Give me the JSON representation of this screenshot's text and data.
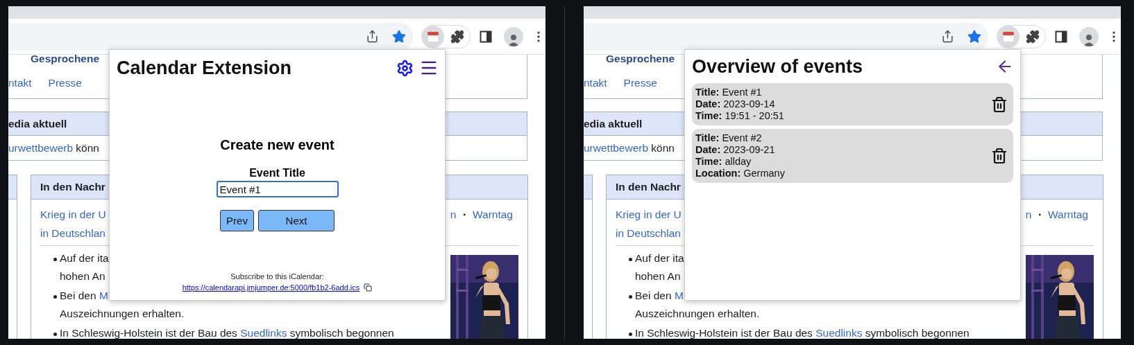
{
  "panes": [
    {
      "wiki": {
        "nav_top": "Gesprochene",
        "nav_links": [
          "ntakt",
          "Presse"
        ],
        "current_title": "edia aktuell",
        "current_text": [
          {
            "kind": "link",
            "text": "urwettbewerb"
          },
          {
            "kind": "text",
            "text": " könn"
          }
        ],
        "news_title": "In den Nachr",
        "news_left": [
          "Krieg in der U",
          "in Deutschlan"
        ],
        "news_right": [
          "n",
          "▪",
          "Warntag"
        ],
        "bullets": [
          {
            "lines": [
              [
                {
                  "kind": "text",
                  "text": "Auf der ita"
                }
              ],
              [
                {
                  "kind": "text",
                  "text": "hohen An"
                }
              ]
            ]
          },
          {
            "lines": [
              [
                {
                  "kind": "text",
                  "text": "Bei den "
                },
                {
                  "kind": "link",
                  "text": "M"
                }
              ],
              [
                {
                  "kind": "text",
                  "text": "Auszeichnungen erhalten."
                }
              ]
            ]
          },
          {
            "lines": [
              [
                {
                  "kind": "text",
                  "text": "In Schleswig-Holstein ist der Bau des "
                },
                {
                  "kind": "link",
                  "text": "Suedlinks"
                },
                {
                  "kind": "text",
                  "text": " symbolisch begonnen"
                }
              ]
            ]
          }
        ]
      },
      "popup": {
        "kind": "create",
        "title": "Calendar Extension",
        "heading": "Create new event",
        "field_label": "Event Title",
        "field_value": "Event #1",
        "buttons": [
          "Prev",
          "Next"
        ],
        "subscribe_text": "Subscribe to this iCalendar:",
        "subscribe_link": "https://calendarapi.jmjumper.de:5000/fb1b2-6add.ics"
      }
    },
    {
      "wiki": {
        "nav_top": "Gesprochene",
        "nav_links": [
          "ntakt",
          "Presse"
        ],
        "current_title": "edia aktuell",
        "current_text": [
          {
            "kind": "link",
            "text": "urwettbewerb"
          },
          {
            "kind": "text",
            "text": " könn"
          }
        ],
        "news_title": "In den Nachr",
        "news_left": [
          "Krieg in der U",
          "in Deutschlan"
        ],
        "news_right": [
          "n",
          "▪",
          "Warntag"
        ],
        "bullets": [
          {
            "lines": [
              [
                {
                  "kind": "text",
                  "text": "Auf der ita"
                }
              ],
              [
                {
                  "kind": "text",
                  "text": "hohen An"
                }
              ]
            ]
          },
          {
            "lines": [
              [
                {
                  "kind": "text",
                  "text": "Bei den "
                },
                {
                  "kind": "link",
                  "text": "M"
                }
              ],
              [
                {
                  "kind": "text",
                  "text": "Auszeichnungen erhalten."
                }
              ]
            ]
          },
          {
            "lines": [
              [
                {
                  "kind": "text",
                  "text": "In Schleswig-Holstein ist der Bau des "
                },
                {
                  "kind": "link",
                  "text": "Suedlinks"
                },
                {
                  "kind": "text",
                  "text": " symbolisch begonnen"
                }
              ]
            ]
          }
        ]
      },
      "popup": {
        "kind": "overview",
        "title": "Overview of events",
        "events": [
          {
            "fields": [
              {
                "label": "Title:",
                "value": "Event #1"
              },
              {
                "label": "Date:",
                "value": "2023-09-14"
              },
              {
                "label": "Time:",
                "value": "19:51 - 20:51"
              }
            ]
          },
          {
            "fields": [
              {
                "label": "Title:",
                "value": "Event #2"
              },
              {
                "label": "Date:",
                "value": "2023-09-21"
              },
              {
                "label": "Time:",
                "value": "allday"
              },
              {
                "label": "Location:",
                "value": "Germany"
              }
            ]
          }
        ]
      }
    }
  ]
}
